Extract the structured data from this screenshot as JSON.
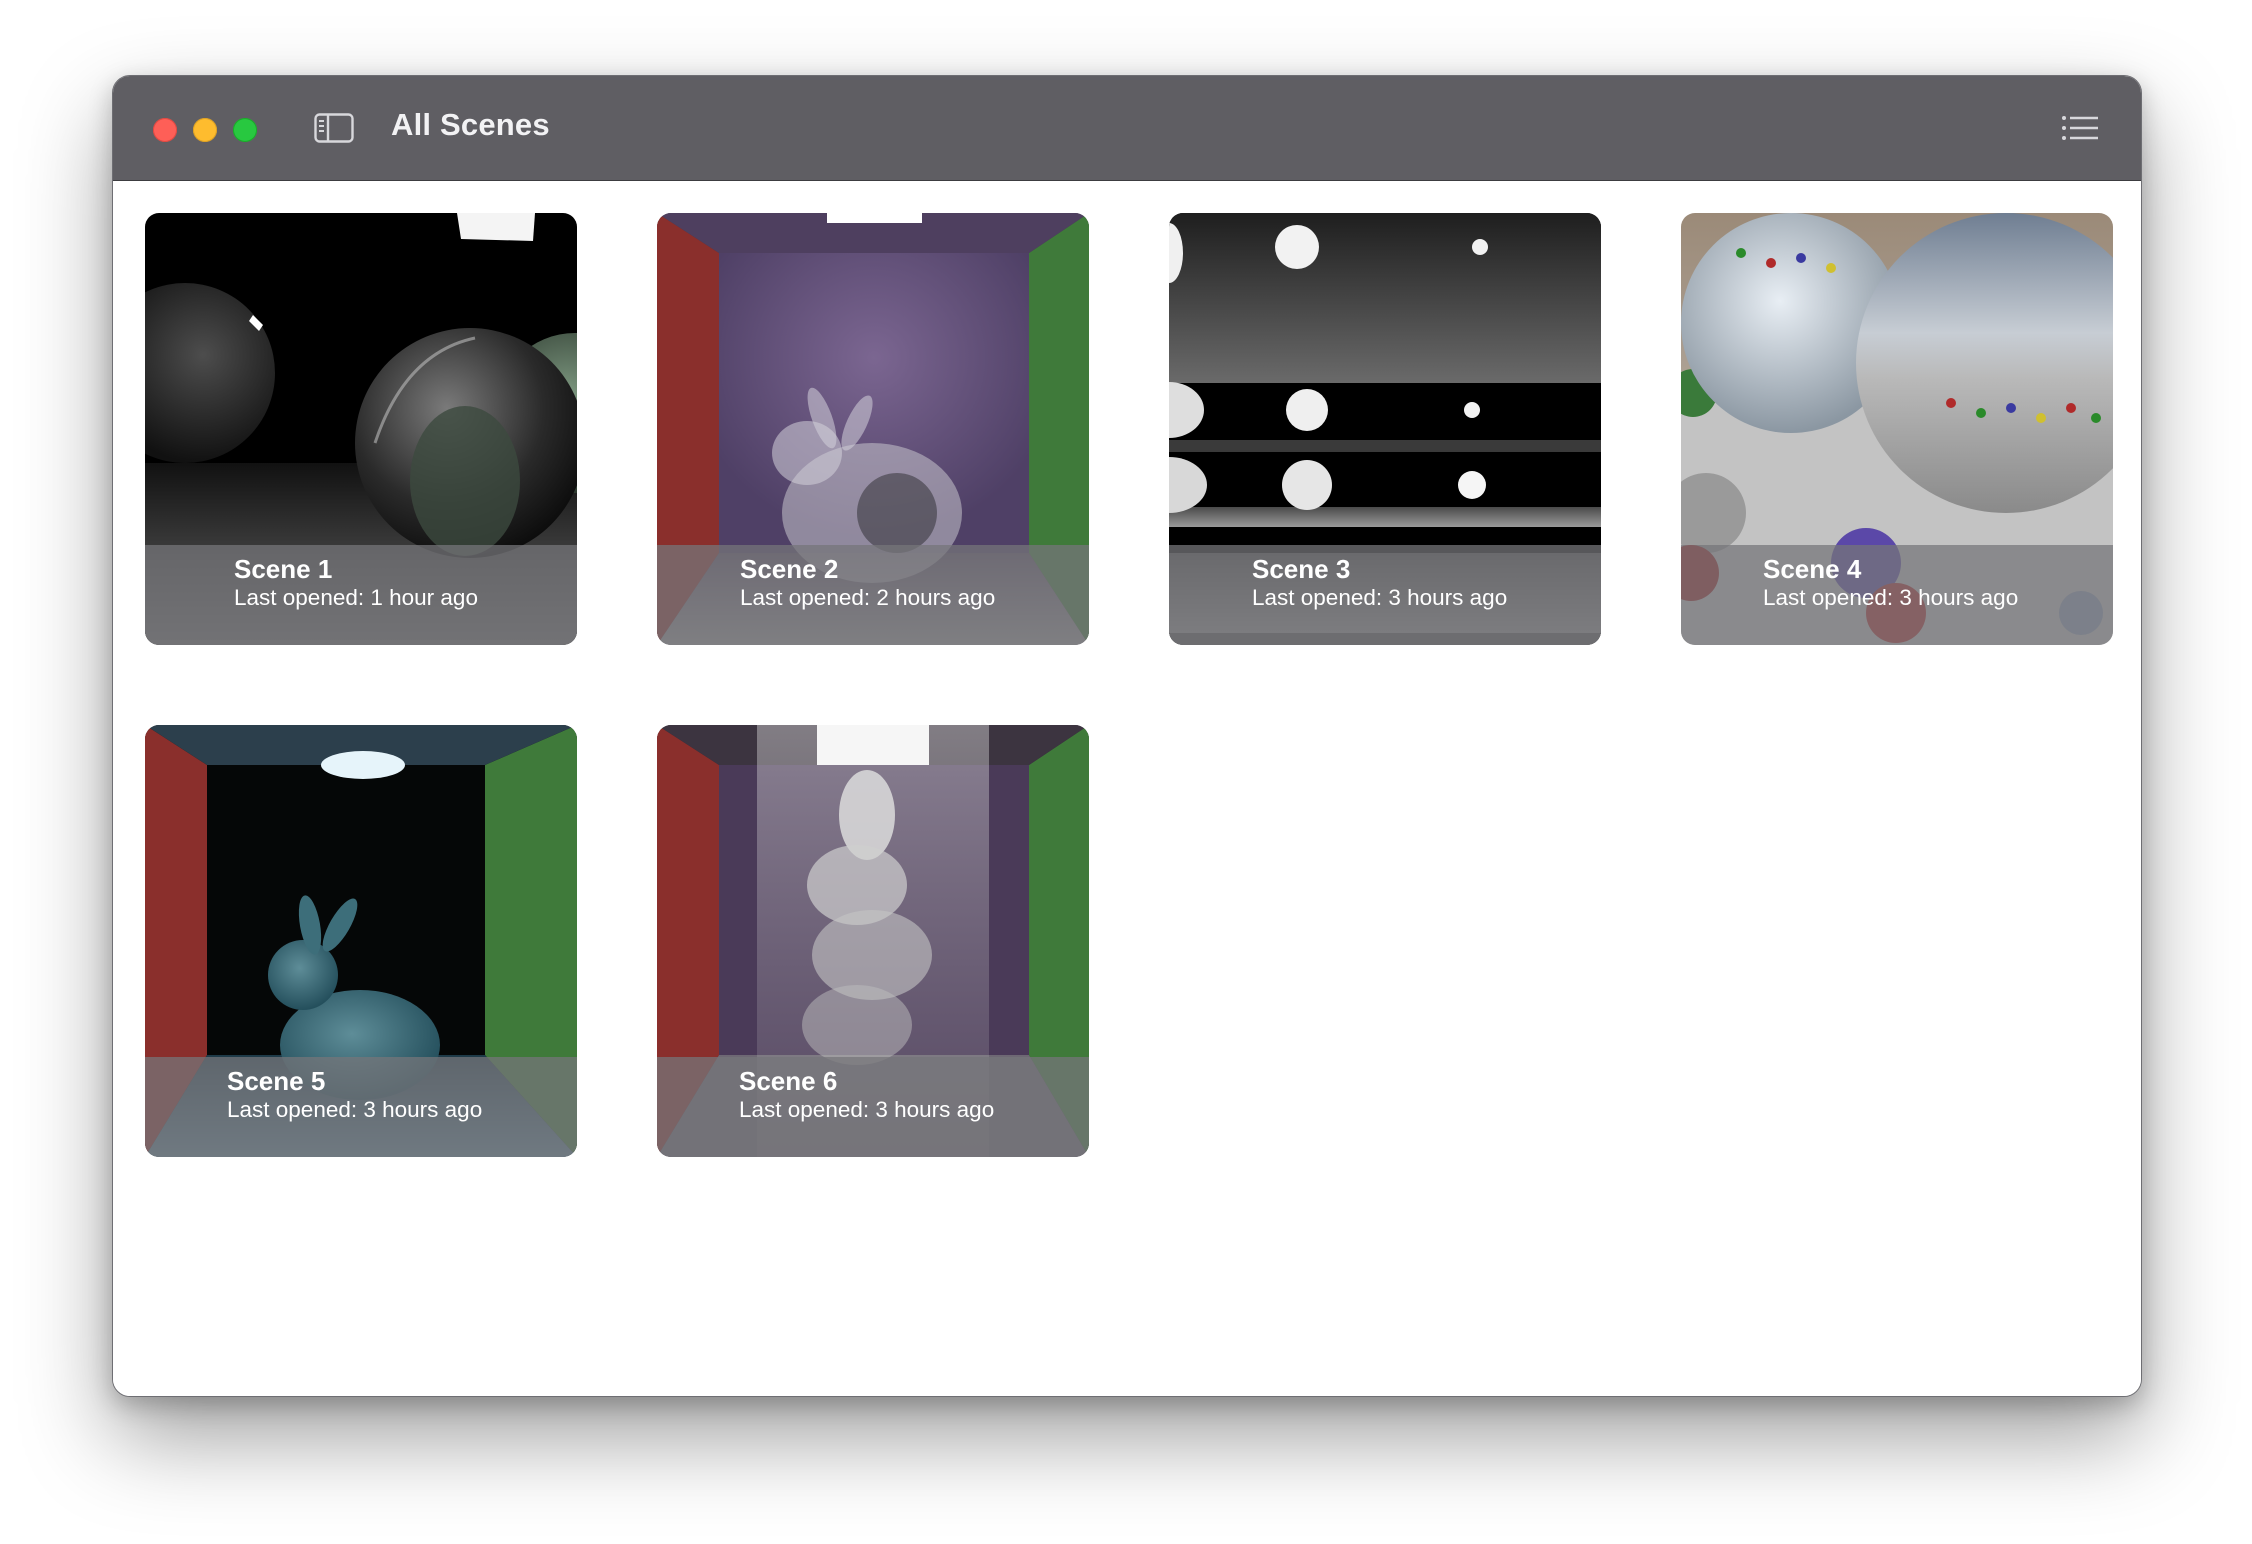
{
  "window": {
    "title": "All Scenes"
  },
  "toolbar": {
    "sidebar_toggle_icon": "sidebar-left-icon",
    "view_mode_icon": "list-bullet-icon"
  },
  "scenes": [
    {
      "name": "Scene 1",
      "last_opened": "Last opened: 1 hour ago"
    },
    {
      "name": "Scene 2",
      "last_opened": "Last opened: 2 hours ago"
    },
    {
      "name": "Scene 3",
      "last_opened": "Last opened: 3 hours ago"
    },
    {
      "name": "Scene 4",
      "last_opened": "Last opened: 3 hours ago"
    },
    {
      "name": "Scene 5",
      "last_opened": "Last opened: 3 hours ago"
    },
    {
      "name": "Scene 6",
      "last_opened": "Last opened: 3 hours ago"
    }
  ],
  "colors": {
    "titlebar": "#5f5e63",
    "traffic_close": "#fe5f57",
    "traffic_minimize": "#febc2e",
    "traffic_maximize": "#28c840"
  }
}
